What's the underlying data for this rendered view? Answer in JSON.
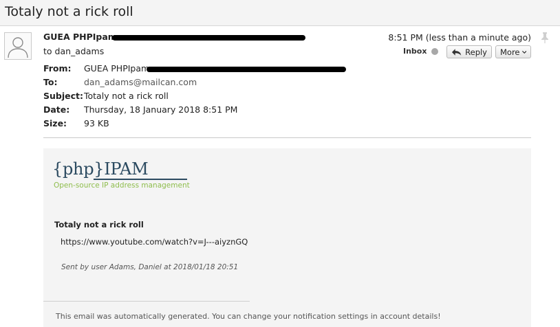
{
  "window": {
    "title": "Totaly not a rick roll"
  },
  "message": {
    "sender_name": "GUEA PHPIpam",
    "to_line": "to dan_adams",
    "time": "8:51 PM (less than a minute ago)",
    "folder": "Inbox",
    "reply_label": "Reply",
    "more_label": "More"
  },
  "headers": {
    "from_key": "From:",
    "from_val": "GUEA PHPIpam",
    "to_key": "To:",
    "to_val": "dan_adams@mailcan.com",
    "subject_key": "Subject:",
    "subject_val": "Totaly not a rick roll",
    "date_key": "Date:",
    "date_val": "Thursday, 18 January 2018 8:51 PM",
    "size_key": "Size:",
    "size_val": "93 KB"
  },
  "body": {
    "logo_text": "{php}IPAM",
    "logo_tagline": "Open-source IP address management",
    "title": "Totaly not a rick roll",
    "url": "https://www.youtube.com/watch?v=J---aiyznGQ",
    "sent_by": "Sent by user Adams, Daniel at 2018/01/18 20:51",
    "footer": "This email was automatically generated. You can change your notification settings in account details!"
  },
  "colors": {
    "logo": "#2b4a60",
    "tagline": "#8ebd4c",
    "redaction": "#000000"
  },
  "icons": {
    "avatar": "person-icon",
    "reply": "reply-arrow-icon",
    "more": "chevron-down-icon",
    "pin": "pin-icon"
  }
}
